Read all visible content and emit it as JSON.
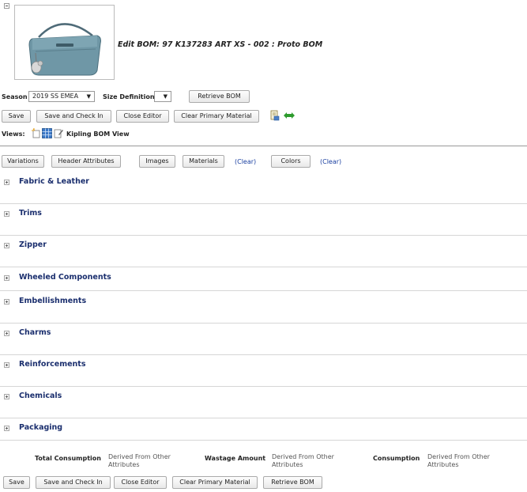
{
  "page": {
    "title": "Edit BOM: 97 K137283 ART XS - 002 : Proto BOM"
  },
  "product_image": {
    "icon": "handbag-image"
  },
  "filters": {
    "season_label": "Season",
    "season_value": "2019 SS EMEA",
    "size_label": "Size Definition",
    "size_value": "",
    "retrieve_label": "Retrieve BOM"
  },
  "toolbar": {
    "save": "Save",
    "save_checkin": "Save and Check In",
    "close_editor": "Close Editor",
    "clear_primary": "Clear Primary Material"
  },
  "views": {
    "label": "Views:",
    "current": "Kipling BOM View"
  },
  "tabs": {
    "variations": "Variations",
    "header_attributes": "Header Attributes",
    "images": "Images",
    "materials": "Materials",
    "clear1": "(Clear)",
    "colors": "Colors",
    "clear2": "(Clear)"
  },
  "sections": [
    "Fabric & Leather",
    "Trims",
    "Zipper",
    "Wheeled Components",
    "Embellishments",
    "Charms",
    "Reinforcements",
    "Chemicals",
    "Packaging"
  ],
  "summary": {
    "total_consumption_label": "Total Consumption",
    "total_consumption_value": "Derived From Other Attributes",
    "wastage_label": "Wastage Amount",
    "wastage_value": "Derived From Other Attributes",
    "consumption_label": "Consumption",
    "consumption_value": "Derived From Other Attributes"
  },
  "bottom_toolbar": {
    "save": "Save",
    "save_checkin": "Save and Check In",
    "close_editor": "Close Editor",
    "clear_primary": "Clear Primary Material",
    "retrieve": "Retrieve BOM"
  }
}
